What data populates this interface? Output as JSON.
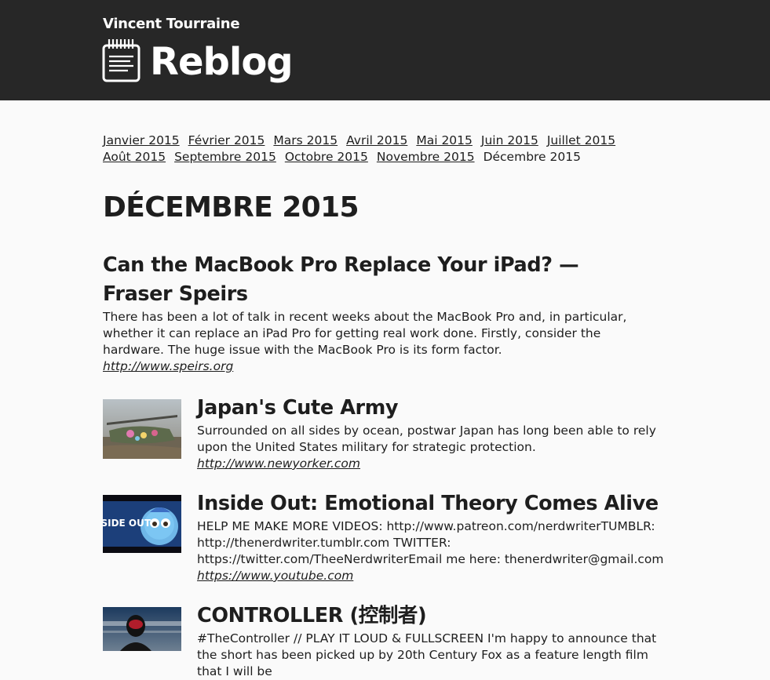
{
  "header": {
    "author": "Vincent Tourraine",
    "site_title": "Reblog",
    "logo_icon": "notepad-icon"
  },
  "months": [
    {
      "label": "Janvier 2015",
      "current": false
    },
    {
      "label": "Février 2015",
      "current": false
    },
    {
      "label": "Mars 2015",
      "current": false
    },
    {
      "label": "Avril 2015",
      "current": false
    },
    {
      "label": "Mai 2015",
      "current": false
    },
    {
      "label": "Juin 2015",
      "current": false
    },
    {
      "label": "Juillet 2015",
      "current": false
    },
    {
      "label": "Août 2015",
      "current": false
    },
    {
      "label": "Septembre 2015",
      "current": false
    },
    {
      "label": "Octobre 2015",
      "current": false
    },
    {
      "label": "Novembre 2015",
      "current": false
    },
    {
      "label": "Décembre 2015",
      "current": true
    }
  ],
  "page_heading": "DÉCEMBRE 2015",
  "posts": [
    {
      "title": "Can the MacBook Pro Replace Your iPad? — Fraser Speirs",
      "excerpt": "There has been a lot of talk in recent weeks about the MacBook Pro and, in particular, whether it can replace an iPad Pro for getting real work done. Firstly, consider the hardware. The huge issue with the MacBook Pro is its form factor.",
      "link": "http://www.speirs.org"
    },
    {
      "title": "Japan's Cute Army",
      "excerpt": "Surrounded on all sides by ocean, postwar Japan has long been able to rely upon the United States military for strategic protection.",
      "link": "http://www.newyorker.com",
      "thumbnail": "japan-army-helicopter-thumbnail"
    },
    {
      "title": "Inside Out: Emotional Theory Comes Alive",
      "excerpt": "HELP ME MAKE MORE VIDEOS: http://www.patreon.com/nerdwriterTUMBLR: http://thenerdwriter.tumblr.com TWITTER: https://twitter.com/TheeNerdwriterEmail me here: thenerdwriter@gmail.com",
      "link": "https://www.youtube.com",
      "thumbnail": "inside-out-thumbnail",
      "thumbnail_caption": "INSIDE OUT"
    },
    {
      "title": "CONTROLLER (控制者)",
      "excerpt": "#TheController // PLAY IT LOUD & FULLSCREEN I'm happy to announce that the short has been picked up by 20th Century Fox as a feature length film that I will be",
      "thumbnail": "controller-masked-figure-thumbnail"
    }
  ],
  "colors": {
    "header_bg": "#272727",
    "page_bg": "#fafafa",
    "text": "#1e1e1e"
  }
}
